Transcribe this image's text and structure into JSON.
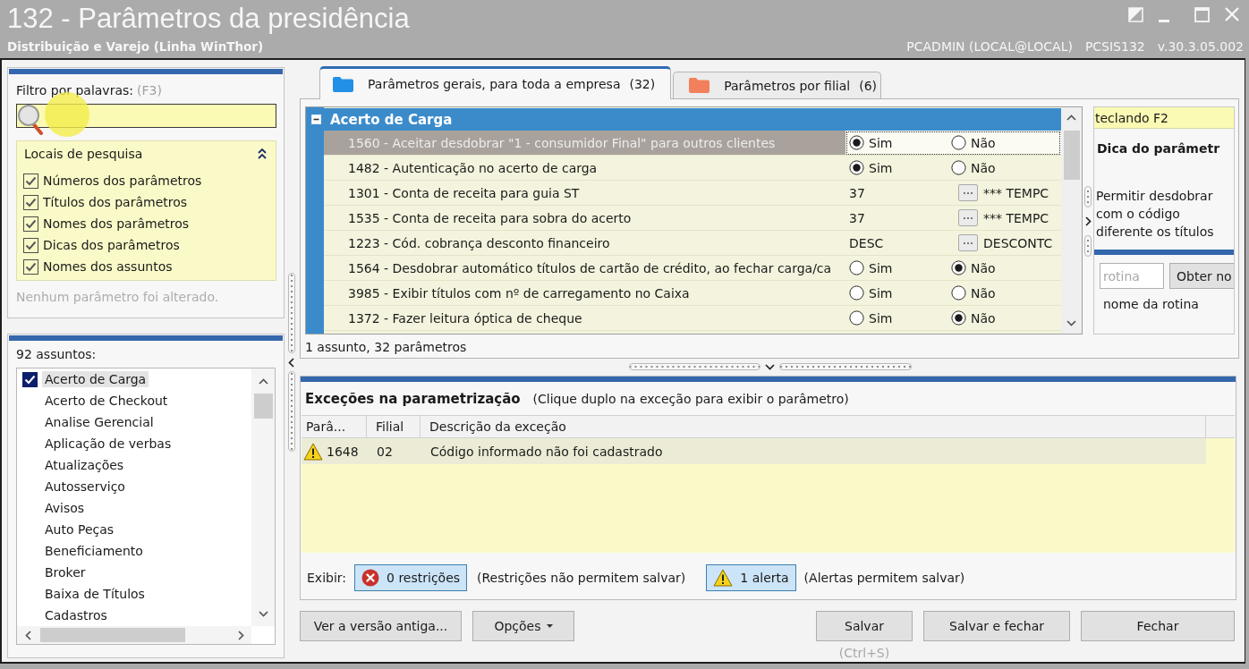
{
  "window": {
    "title": "132 - Parâmetros da presidência",
    "subtitle": "Distribuição e Varejo (Linha WinThor)",
    "user": "PCADMIN (LOCAL@LOCAL)",
    "routine": "PCSIS132",
    "version": "v.30.3.05.002"
  },
  "filter": {
    "label": "Filtro por palavras:",
    "shortcut": "(F3)",
    "search_locations": {
      "title": "Locais de pesquisa",
      "expanded": true,
      "options": [
        {
          "label": "Números dos parâmetros",
          "checked": true
        },
        {
          "label": "Títulos dos parâmetros",
          "checked": true
        },
        {
          "label": "Nomes dos parâmetros",
          "checked": true
        },
        {
          "label": "Dicas dos parâmetros",
          "checked": true
        },
        {
          "label": "Nomes dos assuntos",
          "checked": true
        }
      ]
    },
    "status": "Nenhum parâmetro foi alterado."
  },
  "subjects": {
    "count_label": "92 assuntos:",
    "items": [
      {
        "label": "Acerto de Carga",
        "checked": true,
        "selected": true
      },
      {
        "label": "Acerto de Checkout",
        "checked": false,
        "selected": false
      },
      {
        "label": "Analise Gerencial",
        "checked": false,
        "selected": false
      },
      {
        "label": "Aplicação de verbas",
        "checked": false,
        "selected": false
      },
      {
        "label": "Atualizações",
        "checked": false,
        "selected": false
      },
      {
        "label": "Autosserviço",
        "checked": false,
        "selected": false
      },
      {
        "label": "Avisos",
        "checked": false,
        "selected": false
      },
      {
        "label": "Auto Peças",
        "checked": false,
        "selected": false
      },
      {
        "label": "Beneficiamento",
        "checked": false,
        "selected": false
      },
      {
        "label": "Broker",
        "checked": false,
        "selected": false
      },
      {
        "label": "Baixa de Títulos",
        "checked": false,
        "selected": false
      },
      {
        "label": "Cadastros",
        "checked": false,
        "selected": false
      }
    ]
  },
  "tabs": [
    {
      "label": "Parâmetros gerais, para toda a empresa",
      "count": "(32)",
      "selected": true,
      "color": "#2290e6"
    },
    {
      "label": "Parâmetros por filial",
      "count": "(6)",
      "selected": false,
      "color": "#f3805c"
    }
  ],
  "parameters": {
    "group": {
      "title": "Acerto de Carga",
      "expanded": true
    },
    "rows": [
      {
        "kind": "yes_no",
        "title": "1560 - Aceitar desdobrar \"1 - consumidor Final\" para outros clientes",
        "selected": true,
        "options": [
          {
            "label": "Sim",
            "selected": true
          },
          {
            "label": "Não",
            "selected": false
          }
        ]
      },
      {
        "kind": "yes_no",
        "title": "1482 - Autenticação no acerto de carga",
        "selected": false,
        "options": [
          {
            "label": "Sim",
            "selected": true
          },
          {
            "label": "Não",
            "selected": false
          }
        ]
      },
      {
        "kind": "lookup",
        "title": "1301 - Conta de receita para guia ST",
        "selected": false,
        "value": "37",
        "description": "*** TEMPC"
      },
      {
        "kind": "lookup",
        "title": "1535 - Conta de receita para sobra do acerto",
        "selected": false,
        "value": "37",
        "description": "*** TEMPC"
      },
      {
        "kind": "lookup",
        "title": "1223 - Cód. cobrança desconto financeiro",
        "selected": false,
        "value": "DESC",
        "description": "DESCONTC"
      },
      {
        "kind": "yes_no",
        "title": "1564 - Desdobrar automático títulos de cartão de crédito, ao fechar carga/ca",
        "selected": false,
        "options": [
          {
            "label": "Sim",
            "selected": false
          },
          {
            "label": "Não",
            "selected": true
          }
        ]
      },
      {
        "kind": "yes_no",
        "title": "3985 - Exibir títulos com nº de carregamento no Caixa",
        "selected": false,
        "options": [
          {
            "label": "Sim",
            "selected": false
          },
          {
            "label": "Não",
            "selected": false
          }
        ]
      },
      {
        "kind": "yes_no",
        "title": "1372 - Fazer leitura óptica de cheque",
        "selected": false,
        "options": [
          {
            "label": "Sim",
            "selected": false
          },
          {
            "label": "Não",
            "selected": true
          }
        ]
      }
    ],
    "summary": "1 assunto, 32 parâmetros"
  },
  "hint_panel": {
    "tip": "teclando F2",
    "title": "Dica do parâmetr",
    "text": "Permitir desdobrar com o código diferente os títulos",
    "routine_field": {
      "placeholder": "rotina"
    },
    "lookup_button": "Obter no",
    "routine_name": "nome da rotina"
  },
  "exceptions": {
    "title": "Exceções na parametrização",
    "note": "(Clique duplo na exceção para exibir o parâmetro)",
    "columns": [
      "Parâ...",
      "Filial",
      "Descrição da exceção"
    ],
    "rows": [
      {
        "kind": "alert",
        "selected": true,
        "cells": [
          "1648",
          "02",
          "Código informado não foi cadastrado"
        ]
      }
    ],
    "show_label": "Exibir:",
    "filters": [
      {
        "kind": "restriction",
        "label": "0 restrições",
        "note": "(Restrições não permitem salvar)",
        "selected": true
      },
      {
        "kind": "alert",
        "label": "1 alerta",
        "note": "(Alertas permitem salvar)",
        "selected": true
      }
    ]
  },
  "actions": {
    "left": [
      {
        "label": "Ver a versão antiga...",
        "kind": "push"
      },
      {
        "label": "Opções",
        "kind": "menu"
      }
    ],
    "right": [
      {
        "label": "Salvar",
        "kind": "push",
        "shortcut": "(Ctrl+S)"
      },
      {
        "label": "Salvar e fechar",
        "kind": "push"
      },
      {
        "label": "Fechar",
        "kind": "push"
      }
    ]
  }
}
